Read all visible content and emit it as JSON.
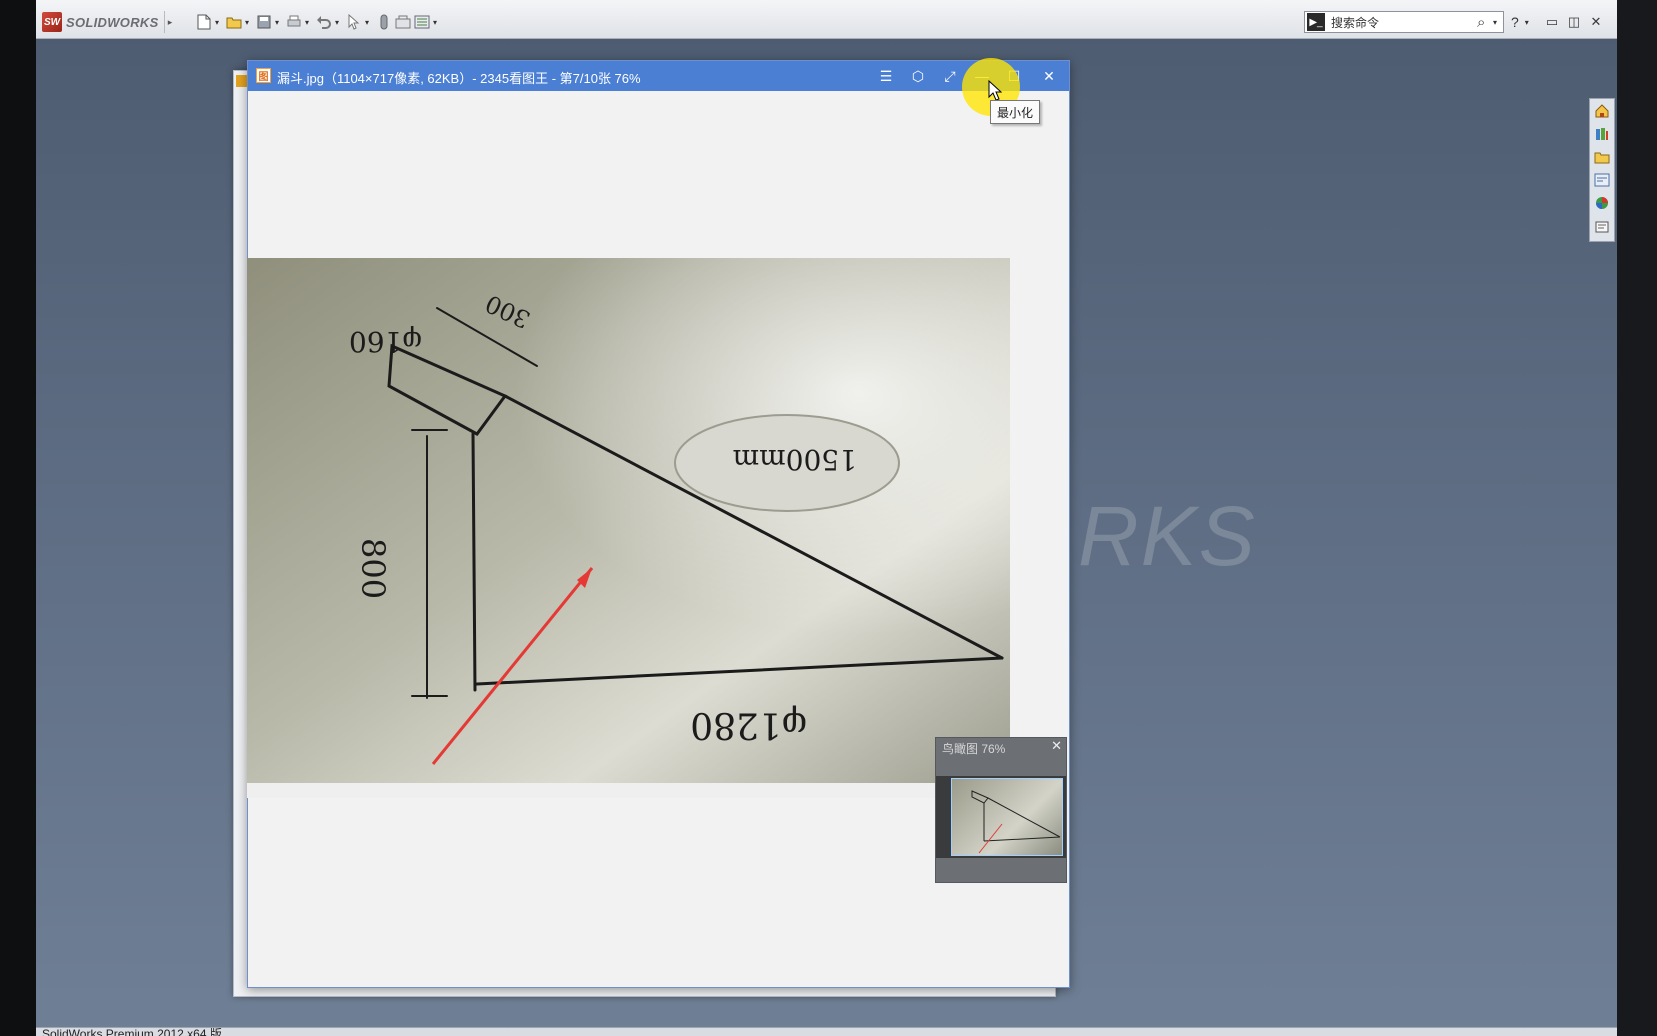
{
  "solidworks": {
    "logo_badge": "SW",
    "logo_text": "SOLIDWORKS",
    "flyout_arrow": "▸",
    "toolbar_icons": [
      "new-document-icon",
      "open-folder-icon",
      "save-icon",
      "print-icon",
      "undo-icon",
      "select-icon",
      "rebuild-icon",
      "file-properties-icon",
      "options-icon"
    ],
    "search_icon_glyph": "▶_",
    "search_placeholder": "搜索命令",
    "search_mag_glyph": "⌕",
    "dropdown_glyph": "▾",
    "help_glyph": "?",
    "minimize_glyph": "▭",
    "restore_glyph": "◫",
    "close_glyph": "✕",
    "watermark": "RKS",
    "status_text": "SolidWorks Premium 2012 x64 版",
    "task_pane_icons": [
      "home-icon",
      "design-library-icon",
      "file-explorer-icon",
      "view-palette-icon",
      "appearances-icon",
      "custom-properties-icon"
    ]
  },
  "viewer": {
    "app_icon_glyph": "图",
    "caption": "漏斗.jpg（1104×717像素, 62KB）- 2345看图王 - 第7/10张 76%",
    "menu_glyph": "☰",
    "skin_glyph": "⬡",
    "fullscreen_glyph": "⤢",
    "minimize_glyph": "—",
    "maximize_glyph": "☐",
    "close_glyph": "✕",
    "tooltip": "最小化",
    "zoom_percent": 76,
    "image_index": 7,
    "image_total": 10
  },
  "sketch": {
    "dim_top_diameter": "φ160",
    "dim_length": "300",
    "dim_height": "800",
    "dim_bottom_diameter": "φ1280",
    "dim_circled": "1500mm"
  },
  "navigator": {
    "title": "鸟瞰图 76%",
    "close_glyph": "✕"
  },
  "colors": {
    "viewer_title": "#4a7fd3",
    "annotation_arrow": "#e53935",
    "cursor_highlight": "#ffe600"
  }
}
